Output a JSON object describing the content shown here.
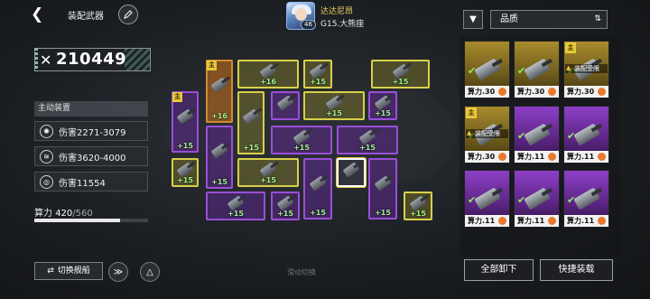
{
  "header": {
    "title": "装配武器",
    "captain_name": "达达尼昂",
    "ship_name": "G15.大熊座",
    "captain_level": "46"
  },
  "left_panel": {
    "power_value": "210449",
    "active_section_title": "主动装置",
    "skills": [
      {
        "text": "伤害2271-3079"
      },
      {
        "text": "伤害3620-4000"
      },
      {
        "text": "伤害11554"
      }
    ],
    "calc_label": "算力",
    "calc_current": "420",
    "calc_max": "/560",
    "calc_progress_fraction": 0.75,
    "switch_ship_label": "切换舰船"
  },
  "grid": {
    "slide_hint": "滑动切换",
    "main_tag": "主",
    "slots": [
      {
        "label": "",
        "color": "orange",
        "main": true
      },
      {
        "label": "+16",
        "color": "yellow",
        "main": false
      },
      {
        "label": "+15",
        "color": "yellow",
        "main": false
      },
      {
        "label": "+15",
        "color": "yellow",
        "main": false
      },
      {
        "label": "+16",
        "color": "orange",
        "main": true
      },
      {
        "label": "+15",
        "color": "purple",
        "main": true
      },
      {
        "label": "",
        "color": "purple",
        "main": false
      },
      {
        "label": "+15",
        "color": "yellow",
        "main": false
      },
      {
        "label": "+15",
        "color": "purple",
        "main": false
      },
      {
        "label": "+15",
        "color": "purple",
        "main": false
      },
      {
        "label": "+15",
        "color": "purple",
        "main": false
      },
      {
        "label": "+15",
        "color": "purple",
        "main": false
      },
      {
        "label": "+15",
        "color": "yellow",
        "main": false
      },
      {
        "label": "+15",
        "color": "yellow",
        "main": false
      },
      {
        "label": "+15",
        "color": "purple",
        "main": false
      },
      {
        "label": "",
        "color": "selected",
        "main": false
      },
      {
        "label": "+15",
        "color": "purple",
        "main": false
      },
      {
        "label": "+15",
        "color": "purple",
        "main": false
      },
      {
        "label": "+15",
        "color": "purple",
        "main": false
      },
      {
        "label": "+15",
        "color": "yellow",
        "main": false
      },
      {
        "label": "+15",
        "color": "yellow",
        "main": false
      }
    ]
  },
  "right_panel": {
    "quality_label": "品质",
    "cards": [
      {
        "footer": "算力.30",
        "color": "gold",
        "main": false,
        "warn": ""
      },
      {
        "footer": "算力.30",
        "color": "gold",
        "main": false,
        "warn": ""
      },
      {
        "footer": "算力.30",
        "color": "gold",
        "main": true,
        "warn": "装配受限"
      },
      {
        "footer": "算力.30",
        "color": "gold",
        "main": true,
        "warn": "装配受限"
      },
      {
        "footer": "算力.11",
        "color": "violet",
        "main": false,
        "warn": ""
      },
      {
        "footer": "算力.11",
        "color": "violet",
        "main": false,
        "warn": ""
      },
      {
        "footer": "算力.11",
        "color": "violet",
        "main": false,
        "warn": ""
      },
      {
        "footer": "算力.11",
        "color": "violet",
        "main": false,
        "warn": ""
      },
      {
        "footer": "算力.11",
        "color": "violet",
        "main": false,
        "warn": ""
      }
    ],
    "unload_all_label": "全部卸下",
    "quick_equip_label": "快捷装载"
  }
}
